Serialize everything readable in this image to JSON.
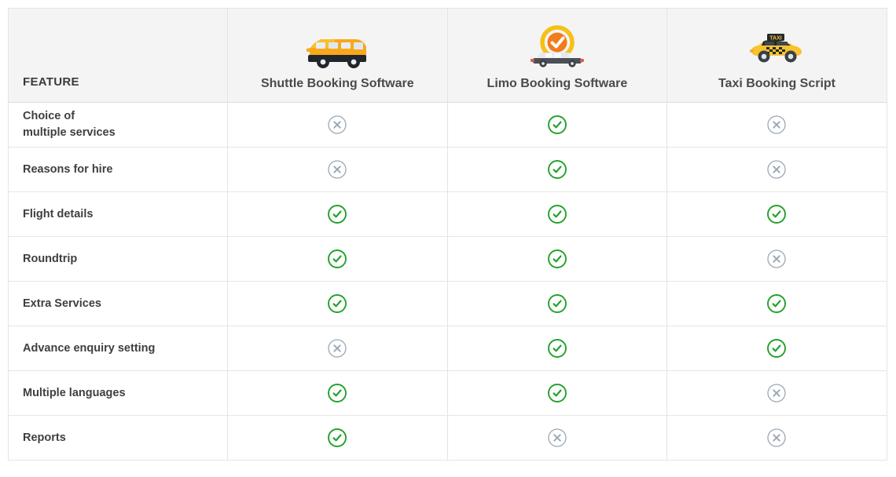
{
  "table": {
    "feature_column_header": "FEATURE",
    "columns": [
      {
        "label": "Shuttle Booking Software",
        "icon": "shuttle-bus-icon"
      },
      {
        "label": "Limo Booking Software",
        "icon": "limo-check-badge-icon"
      },
      {
        "label": "Taxi Booking Script",
        "icon": "taxi-cab-icon"
      }
    ],
    "rows": [
      {
        "feature_line1": "Choice of",
        "feature_line2": "multiple services",
        "values": [
          "no",
          "yes",
          "no"
        ]
      },
      {
        "feature_line1": "Reasons for hire",
        "feature_line2": "",
        "values": [
          "no",
          "yes",
          "no"
        ]
      },
      {
        "feature_line1": "Flight details",
        "feature_line2": "",
        "values": [
          "yes",
          "yes",
          "yes"
        ]
      },
      {
        "feature_line1": "Roundtrip",
        "feature_line2": "",
        "values": [
          "yes",
          "yes",
          "no"
        ]
      },
      {
        "feature_line1": "Extra Services",
        "feature_line2": "",
        "values": [
          "yes",
          "yes",
          "yes"
        ]
      },
      {
        "feature_line1": "Advance enquiry setting",
        "feature_line2": "",
        "values": [
          "no",
          "yes",
          "yes"
        ]
      },
      {
        "feature_line1": "Multiple languages",
        "feature_line2": "",
        "values": [
          "yes",
          "yes",
          "no"
        ]
      },
      {
        "feature_line1": "Reports",
        "feature_line2": "",
        "values": [
          "yes",
          "no",
          "no"
        ]
      }
    ],
    "marks": {
      "yes": {
        "icon": "check-circle-icon",
        "glyph": "✓",
        "color": "#22a12b"
      },
      "no": {
        "icon": "cross-circle-icon",
        "glyph": "✕",
        "color": "#9aa7b4"
      }
    }
  },
  "colors": {
    "header_background": "#f4f4f4",
    "table_border": "#e4e4e4",
    "row_separator": "#e6e6e6",
    "heading_text": "#3a3a3a",
    "feature_text": "#3f3f3f",
    "yes_green": "#22a12b",
    "no_gray": "#9aa7b4",
    "bus_body": "#f7a81b",
    "taxi_body": "#f9c22e",
    "limo_ring": "#f6c015",
    "limo_badge": "#f07c1b"
  }
}
